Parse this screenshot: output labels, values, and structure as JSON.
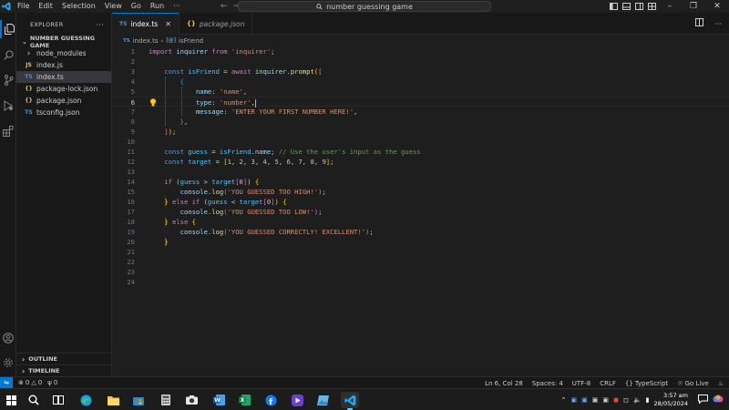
{
  "titlebar": {
    "menu": [
      "File",
      "Edit",
      "Selection",
      "View",
      "Go",
      "Run",
      "···"
    ],
    "search_text": "number guessing game"
  },
  "sidebar": {
    "header": "EXPLORER",
    "folder": "NUMBER GUESSING GAME",
    "items": [
      {
        "label": "node_modules",
        "icon": "chevron-right-icon",
        "glyph": "›"
      },
      {
        "label": "index.js",
        "icon": "js-file-icon",
        "glyph": "JS"
      },
      {
        "label": "index.ts",
        "icon": "ts-file-icon",
        "glyph": "TS"
      },
      {
        "label": "package-lock.json",
        "icon": "json-file-icon",
        "glyph": "{}"
      },
      {
        "label": "package.json",
        "icon": "json-file-icon",
        "glyph": "{}"
      },
      {
        "label": "tsconfig.json",
        "icon": "tsconfig-file-icon",
        "glyph": "TS"
      }
    ],
    "outline": "OUTLINE",
    "timeline": "TIMELINE"
  },
  "tabs": [
    {
      "label": "index.ts",
      "active": true
    },
    {
      "label": "package.json",
      "active": false
    }
  ],
  "breadcrumb": {
    "file": "index.ts",
    "symbol": "isFriend"
  },
  "code": {
    "line_numbers": [
      "1",
      "2",
      "3",
      "4",
      "5",
      "6",
      "7",
      "8",
      "9",
      "10",
      "11",
      "12",
      "13",
      "14",
      "15",
      "16",
      "17",
      "18",
      "19",
      "20",
      "21",
      "22",
      "23",
      "24"
    ],
    "current_line": 6,
    "tokens": {
      "l1_import": "import",
      "l1_name": "inquirer",
      "l1_from": "from",
      "l1_str": "'inquirer'",
      "l3_const": "const",
      "l3_name": "isFriend",
      "l3_await": "await",
      "l3_obj": "inquirer",
      "l3_fn": "prompt",
      "l5_key": "name",
      "l5_val": "'name'",
      "l6_key": "type",
      "l6_val": "'number'",
      "l7_key": "message",
      "l7_val": "'ENTER YOUR FIRST NUMBER HERE!'",
      "l11_const": "const",
      "l11_name": "guess",
      "l11_obj": "isFriend",
      "l11_prop": "name",
      "l11_comment": "// Use the user's input as the guess",
      "l12_const": "const",
      "l12_name": "target",
      "l12_nums": [
        "1",
        "2",
        "3",
        "4",
        "5",
        "6",
        "7",
        "8",
        "9"
      ],
      "l14_if": "if",
      "l14_a": "guess",
      "l14_b": "target",
      "l14_idx": "0",
      "log_obj": "console",
      "log_fn": "log",
      "l15_str": "'YOU GUESSED TOO HIGH!'",
      "l16_else": "else",
      "l16_if": "if",
      "l16_a": "guess",
      "l16_b": "target",
      "l16_idx": "0",
      "l17_str": "'YOU GUESSED TOO LOW!'",
      "l18_else": "else",
      "l19_str": "'YOU GUESSED CORRECTLY! EXCELLENT!'"
    }
  },
  "statusbar": {
    "errors": "0",
    "warnings": "0",
    "ports": "0",
    "position": "Ln 6, Col 28",
    "spaces": "Spaces: 4",
    "encoding": "UTF-8",
    "eol": "CRLF",
    "language": "TypeScript",
    "golive": "Go Live"
  },
  "taskbar": {
    "time": "3:57 am",
    "date": "28/05/2024"
  },
  "colors": {
    "accent": "#0078d4",
    "keyword": "#c586c0",
    "storage": "#569cd6",
    "string": "#ce9178",
    "number": "#b5cea8",
    "comment": "#6a9955"
  }
}
